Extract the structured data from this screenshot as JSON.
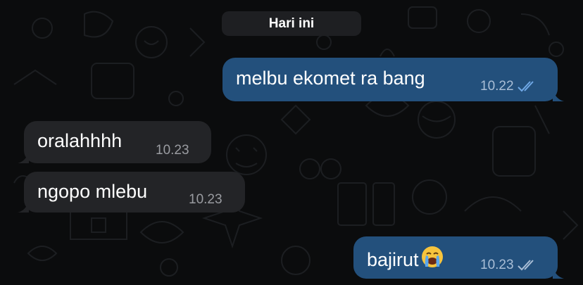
{
  "chat": {
    "date_label": "Hari ini",
    "messages": [
      {
        "direction": "outgoing",
        "text": "melbu ekomet ra bang",
        "time": "10.22",
        "status_icon": "read-double-check-icon"
      },
      {
        "direction": "incoming",
        "text": "oralahhhh",
        "time": "10.23"
      },
      {
        "direction": "incoming",
        "text": "ngopo mlebu",
        "time": "10.23"
      },
      {
        "direction": "outgoing",
        "text": "bajirut",
        "emoji": "loudly-crying-face-icon",
        "time": "10.23",
        "status_icon": "delivered-double-check-icon"
      }
    ]
  },
  "colors": {
    "background": "#0b0c0d",
    "outgoing_bubble": "#23507c",
    "incoming_bubble": "#232427",
    "read_check": "#6fa8e6",
    "delivered_check": "#a9bed6"
  }
}
